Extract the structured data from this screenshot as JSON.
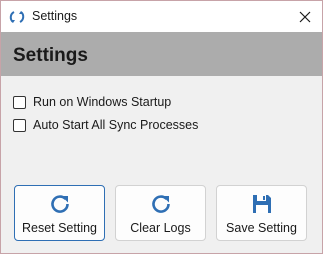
{
  "window": {
    "title": "Settings"
  },
  "header": {
    "title": "Settings"
  },
  "options": [
    {
      "label": "Run on Windows Startup",
      "checked": false
    },
    {
      "label": "Auto Start All Sync Processes",
      "checked": false
    }
  ],
  "buttons": [
    {
      "label": "Reset Setting",
      "icon": "refresh-icon"
    },
    {
      "label": "Clear Logs",
      "icon": "refresh-icon"
    },
    {
      "label": "Save Setting",
      "icon": "floppy-disk-icon"
    }
  ],
  "colors": {
    "accent": "#2f6fb4",
    "header_bg": "#acacac"
  }
}
